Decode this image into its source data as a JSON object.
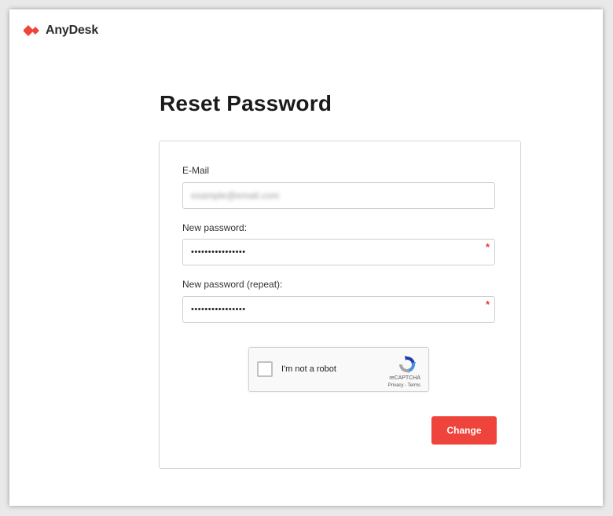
{
  "brand": {
    "name": "AnyDesk",
    "accent_color": "#ef443b"
  },
  "page": {
    "title": "Reset Password"
  },
  "form": {
    "email": {
      "label": "E-Mail",
      "value": "example@email.com"
    },
    "new_password": {
      "label": "New password:",
      "value": "••••••••••••••••",
      "required_mark": "*"
    },
    "repeat_password": {
      "label": "New password (repeat):",
      "value": "••••••••••••••••",
      "required_mark": "*"
    },
    "captcha": {
      "label": "I'm not a robot",
      "brand": "reCAPTCHA",
      "links": "Privacy - Terms",
      "checked": false
    },
    "submit_label": "Change"
  }
}
